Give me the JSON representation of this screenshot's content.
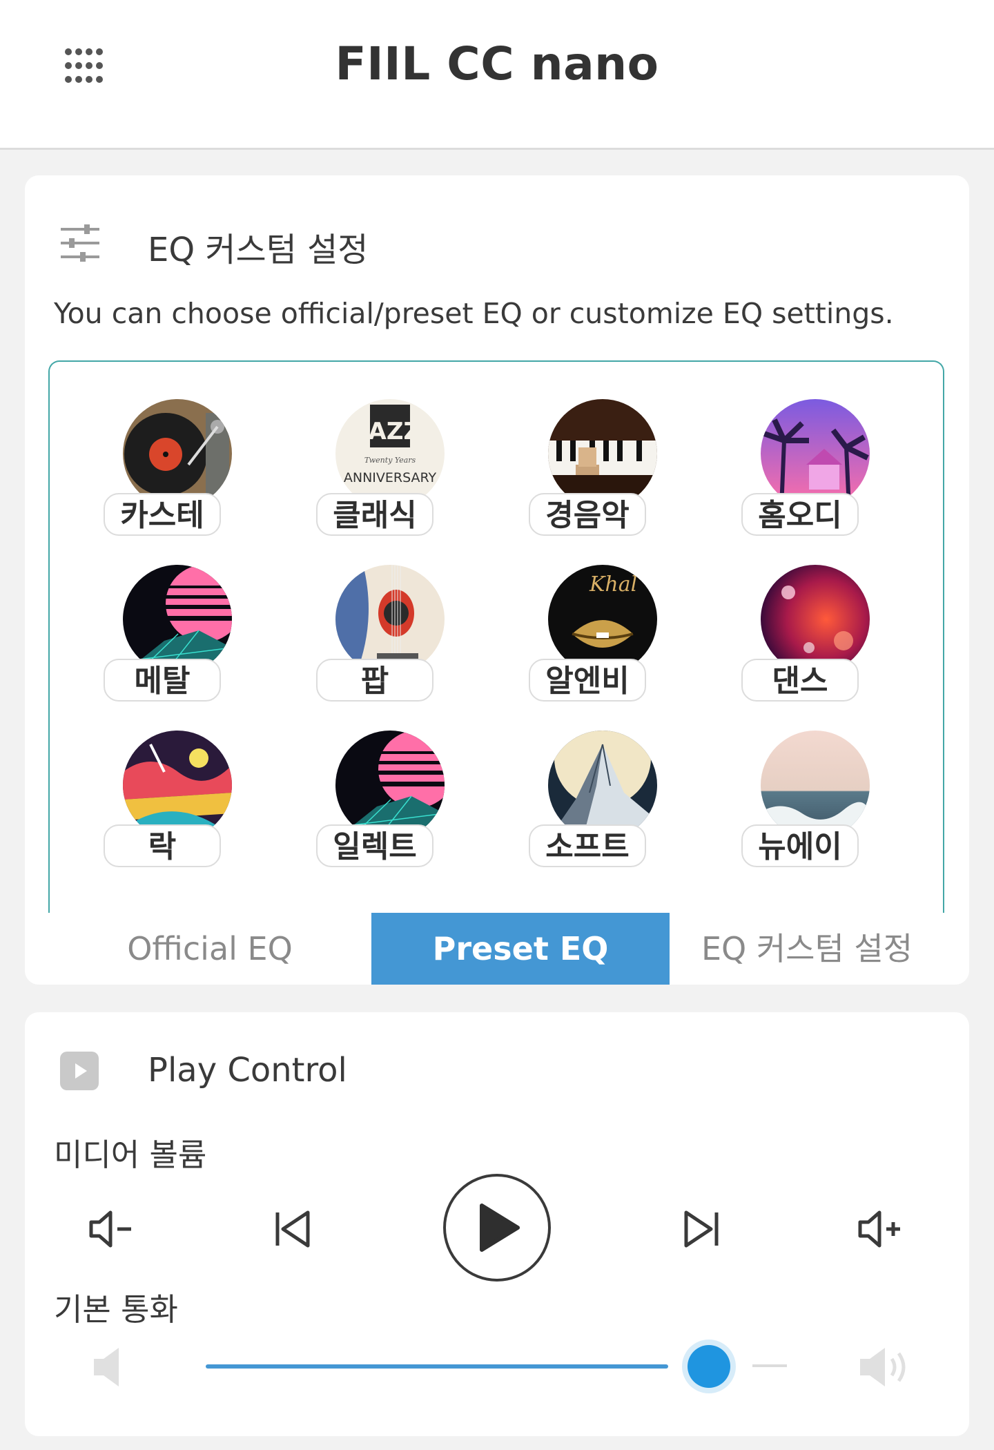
{
  "header": {
    "title": "FIIL CC nano"
  },
  "eq": {
    "title": "EQ 커스텀 설정",
    "description": "You can choose official/preset EQ or customize EQ settings.",
    "presets": [
      {
        "label": "카스테",
        "image": "turntable-image"
      },
      {
        "label": "클래식",
        "image": "jazz-poster-image"
      },
      {
        "label": "경음악",
        "image": "piano-image"
      },
      {
        "label": "홈오디",
        "image": "palm-neon-image"
      },
      {
        "label": "메탈",
        "image": "retro-sun-image"
      },
      {
        "label": "팝",
        "image": "guitar-image"
      },
      {
        "label": "알엔비",
        "image": "gold-lips-image"
      },
      {
        "label": "댄스",
        "image": "red-lights-image"
      },
      {
        "label": "락",
        "image": "colorful-art-image"
      },
      {
        "label": "일렉트",
        "image": "retro-sun-image"
      },
      {
        "label": "소프트",
        "image": "mountain-moon-image"
      },
      {
        "label": "뉴에이",
        "image": "ocean-wave-image"
      }
    ],
    "tabs": [
      {
        "label": "Official EQ",
        "active": false
      },
      {
        "label": "Preset EQ",
        "active": true
      },
      {
        "label": "EQ 커스텀 설정",
        "active": false
      }
    ],
    "accent_color": "#4497d4",
    "panel_border_color": "#43a7a7"
  },
  "play": {
    "title": "Play Control",
    "media_volume_label": "미디어 볼륨",
    "call_label": "기본 통화",
    "controls": [
      "volume-down-icon",
      "previous-track-icon",
      "play-icon",
      "next-track-icon",
      "volume-up-icon"
    ],
    "call_volume_level": 0.82
  }
}
